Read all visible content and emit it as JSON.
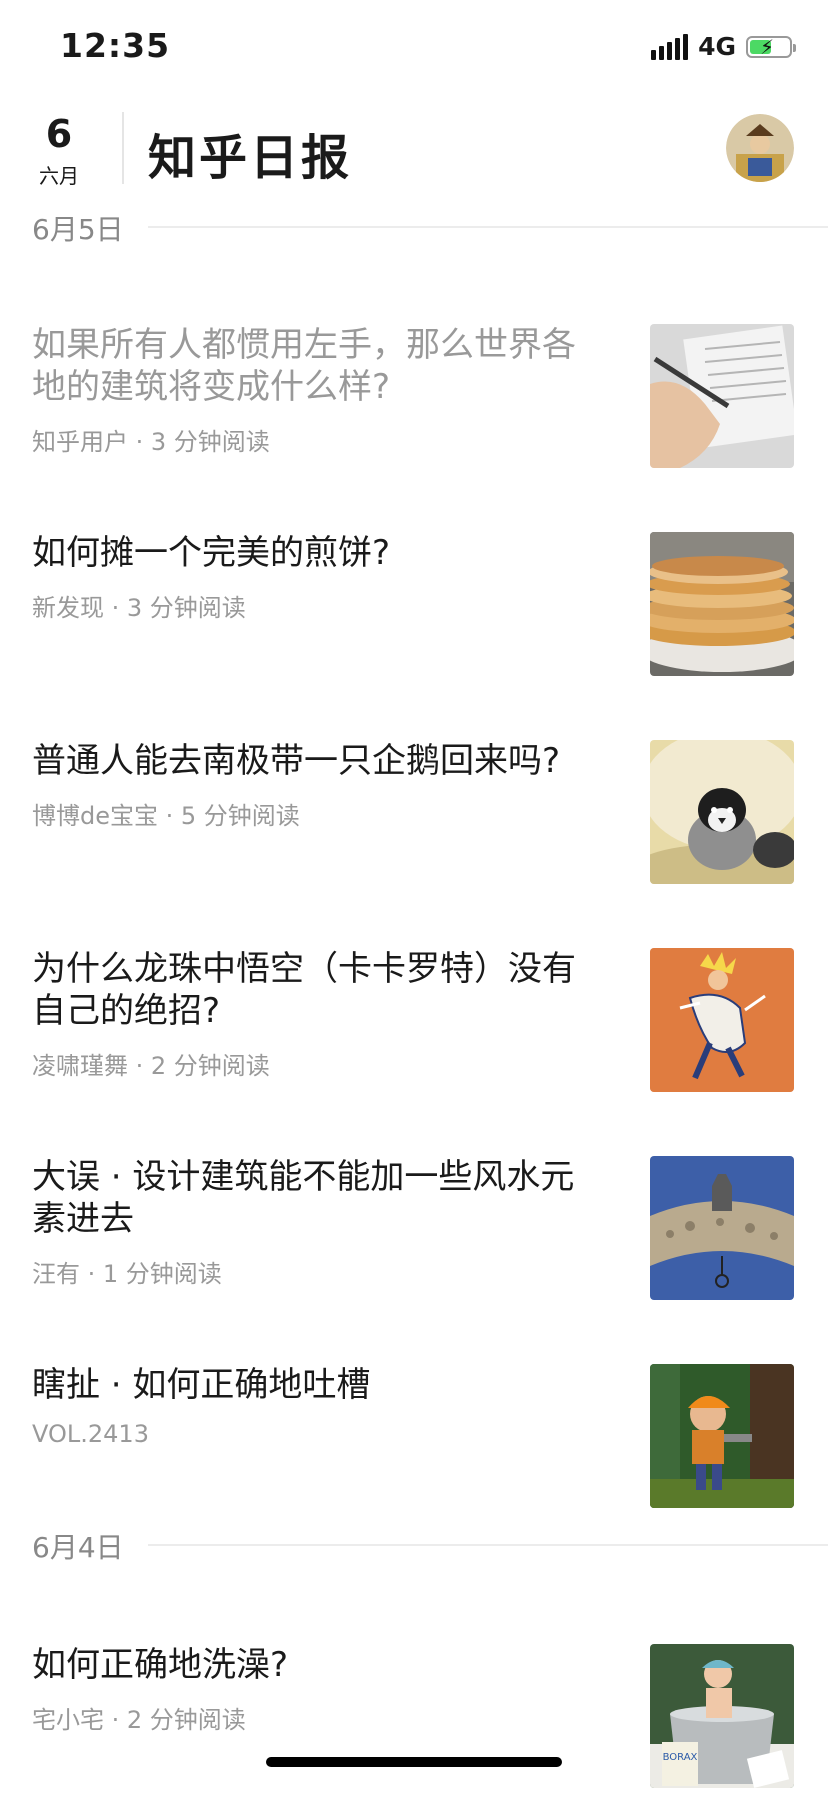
{
  "status": {
    "time": "12:35",
    "network": "4G",
    "battery_level": 0.55
  },
  "header": {
    "day": "6",
    "month": "六月",
    "title": "知乎日报"
  },
  "sections": [
    {
      "date": "6月5日",
      "stories": [
        {
          "title": "如果所有人都惯用左手，那么世界各地的建筑将变成什么样?",
          "meta": "知乎用户 · 3 分钟阅读",
          "read": true,
          "thumb": "hand-writing-image"
        },
        {
          "title": "如何摊一个完美的煎饼?",
          "meta": "新发现 · 3 分钟阅读",
          "read": false,
          "thumb": "pancakes-image"
        },
        {
          "title": "普通人能去南极带一只企鹅回来吗?",
          "meta": "博博de宝宝 · 5 分钟阅读",
          "read": false,
          "thumb": "penguin-image"
        },
        {
          "title": "为什么龙珠中悟空（卡卡罗特）没有自己的绝招?",
          "meta": "凌啸瑾舞 · 2 分钟阅读",
          "read": false,
          "thumb": "goku-image"
        },
        {
          "title": "大误 · 设计建筑能不能加一些风水元素进去",
          "meta": "汪有 · 1 分钟阅读",
          "read": false,
          "thumb": "arch-image"
        },
        {
          "title": "瞎扯 · 如何正确地吐槽",
          "meta": "VOL.2413",
          "read": false,
          "thumb": "cartoon-image"
        }
      ]
    },
    {
      "date": "6月4日",
      "stories": [
        {
          "title": "如何正确地洗澡?",
          "meta": "宅小宅 · 2 分钟阅读",
          "read": false,
          "thumb": "baby-bath-image"
        }
      ]
    }
  ]
}
